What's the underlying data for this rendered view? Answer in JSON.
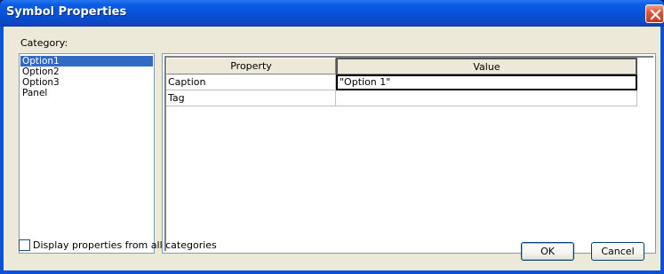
{
  "window": {
    "title": "Symbol Properties"
  },
  "category": {
    "label": "Category:",
    "items": [
      {
        "label": "Option1",
        "selected": true
      },
      {
        "label": "Option2",
        "selected": false
      },
      {
        "label": "Option3",
        "selected": false
      },
      {
        "label": "Panel",
        "selected": false
      }
    ]
  },
  "grid": {
    "headers": {
      "property": "Property",
      "value": "Value"
    },
    "rows": [
      {
        "property": "Caption",
        "value": "\"Option 1\""
      },
      {
        "property": "Tag",
        "value": ""
      }
    ]
  },
  "footer": {
    "checkbox_label": "Display properties from all categories",
    "checkbox_checked": false,
    "ok_label": "OK",
    "cancel_label": "Cancel"
  },
  "colors": {
    "titlebar": "#0850d6",
    "selection": "#316ac5",
    "dialog_bg": "#ece9d8",
    "close_button": "#e0553a"
  },
  "icons": {
    "close": "close-icon"
  }
}
